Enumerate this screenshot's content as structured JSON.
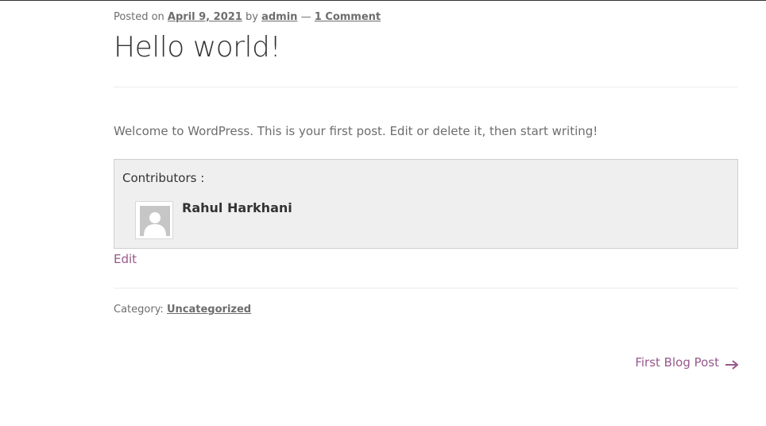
{
  "post": {
    "meta": {
      "posted_on": "Posted on",
      "date": "April 9, 2021",
      "by": "by",
      "author": "admin",
      "dash": "—",
      "comments": "1 Comment"
    },
    "title": "Hello world!",
    "content": "Welcome to WordPress. This is your first post. Edit or delete it, then start writing!",
    "contributors": {
      "label": "Contributors :",
      "items": [
        {
          "name": "Rahul Harkhani",
          "avatar_icon": "default-avatar-icon"
        }
      ]
    },
    "edit_label": "Edit",
    "category": {
      "label": "Category:",
      "value": "Uncategorized"
    }
  },
  "navigation": {
    "next_label": "First Blog Post",
    "next_icon": "arrow-right-icon"
  },
  "colors": {
    "link_accent": "#96588a",
    "text": "#6d6d6d",
    "heading": "#333333",
    "contrib_bg": "#efefef"
  }
}
